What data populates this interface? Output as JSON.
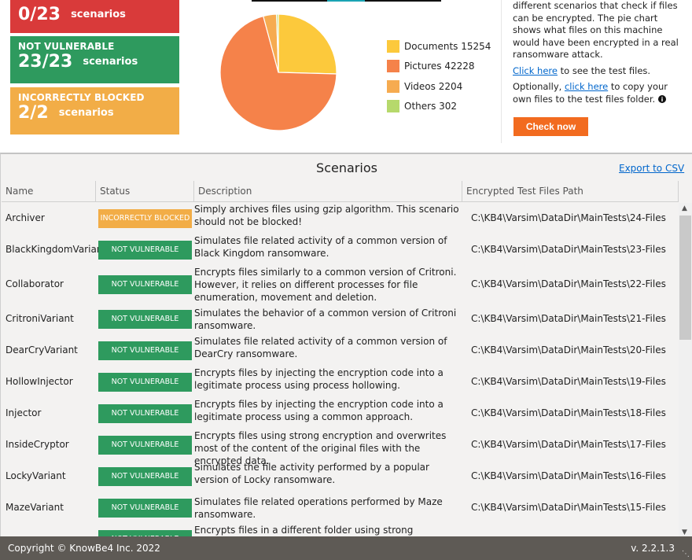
{
  "cards": {
    "vulnerable": {
      "value": "0/23",
      "unit": "scenarios",
      "color": "#d93a3a"
    },
    "not_vulnerable": {
      "title": "NOT VULNERABLE",
      "value": "23/23",
      "unit": "scenarios",
      "color": "#2e9a5e"
    },
    "incorrectly_blocked": {
      "title": "INCORRECTLY BLOCKED",
      "value": "2/2",
      "unit": "scenarios",
      "color": "#f2ad47"
    }
  },
  "pie": {
    "legend": [
      {
        "label": "Documents 15254",
        "color": "#fcc93c",
        "value": 15254
      },
      {
        "label": "Pictures 42228",
        "color": "#f5824a",
        "value": 42228
      },
      {
        "label": "Videos 2204",
        "color": "#f6ab50",
        "value": 2204
      },
      {
        "label": "Others 302",
        "color": "#b6d96c",
        "value": 302
      }
    ]
  },
  "info": {
    "para1": "different scenarios that check if files can be encrypted. The pie chart shows what files on this machine would have been encrypted in a real ransomware attack.",
    "link1": "Click here",
    "para2_rest": " to see the test files.",
    "para3_pre": "Optionally, ",
    "link2": "click here",
    "para3_rest": " to copy your own files to the test files folder.",
    "info_icon": "info-circle-icon",
    "check_button": "Check now"
  },
  "scenarios": {
    "title": "Scenarios",
    "export_label": "Export to CSV",
    "columns": [
      "Name",
      "Status",
      "Description",
      "Encrypted Test Files Path"
    ],
    "rows": [
      {
        "name": "Archiver",
        "status": "INCORRECTLY BLOCKED",
        "desc": "Simply archives files using gzip algorithm. This scenario should not be blocked!",
        "path": "C:\\KB4\\Varsim\\DataDir\\MainTests\\24-Files"
      },
      {
        "name": "BlackKingdomVariant",
        "status": "NOT VULNERABLE",
        "desc": "Simulates file related activity of a common version of Black Kingdom ransomware.",
        "path": "C:\\KB4\\Varsim\\DataDir\\MainTests\\23-Files"
      },
      {
        "name": "Collaborator",
        "status": "NOT VULNERABLE",
        "desc": "Encrypts files similarly to a common version of Critroni. However, it relies on different processes for file enumeration, movement and deletion.",
        "path": "C:\\KB4\\Varsim\\DataDir\\MainTests\\22-Files"
      },
      {
        "name": "CritroniVariant",
        "status": "NOT VULNERABLE",
        "desc": "Simulates the behavior of a common version of Critroni ransomware.",
        "path": "C:\\KB4\\Varsim\\DataDir\\MainTests\\21-Files"
      },
      {
        "name": "DearCryVariant",
        "status": "NOT VULNERABLE",
        "desc": "Simulates file related activity of a common version of DearCry ransomware.",
        "path": "C:\\KB4\\Varsim\\DataDir\\MainTests\\20-Files"
      },
      {
        "name": "HollowInjector",
        "status": "NOT VULNERABLE",
        "desc": "Encrypts files by injecting the encryption code into a legitimate process using process hollowing.",
        "path": "C:\\KB4\\Varsim\\DataDir\\MainTests\\19-Files"
      },
      {
        "name": "Injector",
        "status": "NOT VULNERABLE",
        "desc": "Encrypts files by injecting the encryption code into a legitimate process using a common approach.",
        "path": "C:\\KB4\\Varsim\\DataDir\\MainTests\\18-Files"
      },
      {
        "name": "InsideCryptor",
        "status": "NOT VULNERABLE",
        "desc": "Encrypts files using strong encryption and overwrites most of the content of the original files with the encrypted data.",
        "path": "C:\\KB4\\Varsim\\DataDir\\MainTests\\17-Files"
      },
      {
        "name": "LockyVariant",
        "status": "NOT VULNERABLE",
        "desc": "Simulates the file activity performed by a popular version of Locky ransomware.",
        "path": "C:\\KB4\\Varsim\\DataDir\\MainTests\\16-Files"
      },
      {
        "name": "MazeVariant",
        "status": "NOT VULNERABLE",
        "desc": "Simulates file related operations performed by Maze ransomware.",
        "path": "C:\\KB4\\Varsim\\DataDir\\MainTests\\15-Files"
      },
      {
        "name": "",
        "status": "NOT VULNERABLE",
        "desc": "Encrypts files in a different folder using strong encryption and",
        "path": ""
      }
    ]
  },
  "footer": {
    "copyright": "Copyright © KnowBe4 Inc. 2022",
    "version": "v. 2.2.1.3"
  }
}
